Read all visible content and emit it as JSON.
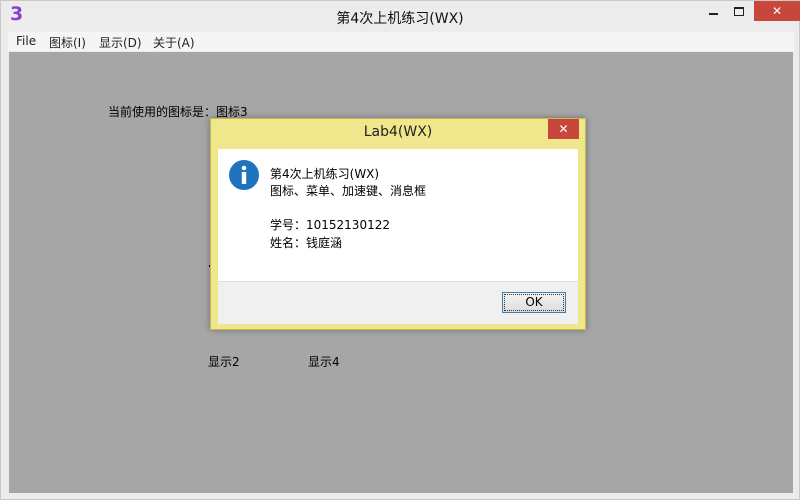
{
  "window": {
    "app_icon_text": "3",
    "title": "第4次上机练习(WX)",
    "close_symbol": "✕"
  },
  "menu": {
    "items": [
      {
        "label": "File"
      },
      {
        "label": "图标(I)"
      },
      {
        "label": "显示(D)"
      },
      {
        "label": "关于(A)"
      }
    ]
  },
  "client": {
    "current_icon_text": "当前使用的图标是：图标3",
    "show2": "显示2",
    "show4": "显示4",
    "background_color": "#a6a6a6"
  },
  "dialog": {
    "title": "Lab4(WX)",
    "close_symbol": "✕",
    "icon": "info-icon",
    "lines": [
      "第4次上机练习(WX)",
      "图标、菜单、加速键、消息框",
      "学号：10152130122",
      "姓名：钱庭涵"
    ],
    "ok_label": "OK",
    "frame_color": "#f0e68c"
  },
  "colors": {
    "close_button": "#c7473d",
    "info_blue": "#1e73be"
  }
}
